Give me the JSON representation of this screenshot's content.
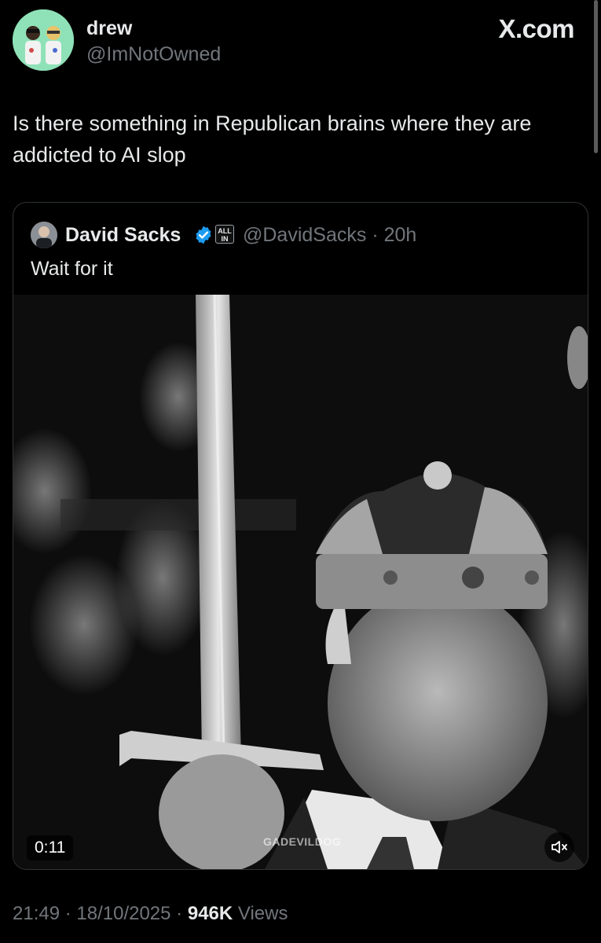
{
  "post": {
    "author_name": "drew",
    "author_handle": "@ImNotOwned",
    "brand": "X.com",
    "text": "Is there something in Republican brains where they are addicted to AI slop",
    "timestamp": "21:49 · 18/10/2025 ·",
    "views_count": "946K",
    "views_label": "Views"
  },
  "quote": {
    "author_name": "David Sacks",
    "affiliate_badge": "ALL IN",
    "handle_time": "@DavidSacks · 20h",
    "text": "Wait for it",
    "video_duration": "0:11",
    "watermark": "GADEVILDOG"
  },
  "icons": {
    "verified": "verified-badge-icon",
    "mute": "volume-muted-icon"
  },
  "colors": {
    "background": "#000000",
    "text_primary": "#e7e9ea",
    "text_secondary": "#71767b",
    "verified_blue": "#1d9bf0",
    "border": "#2f3336",
    "avatar_bg": "#8fe2b8"
  }
}
